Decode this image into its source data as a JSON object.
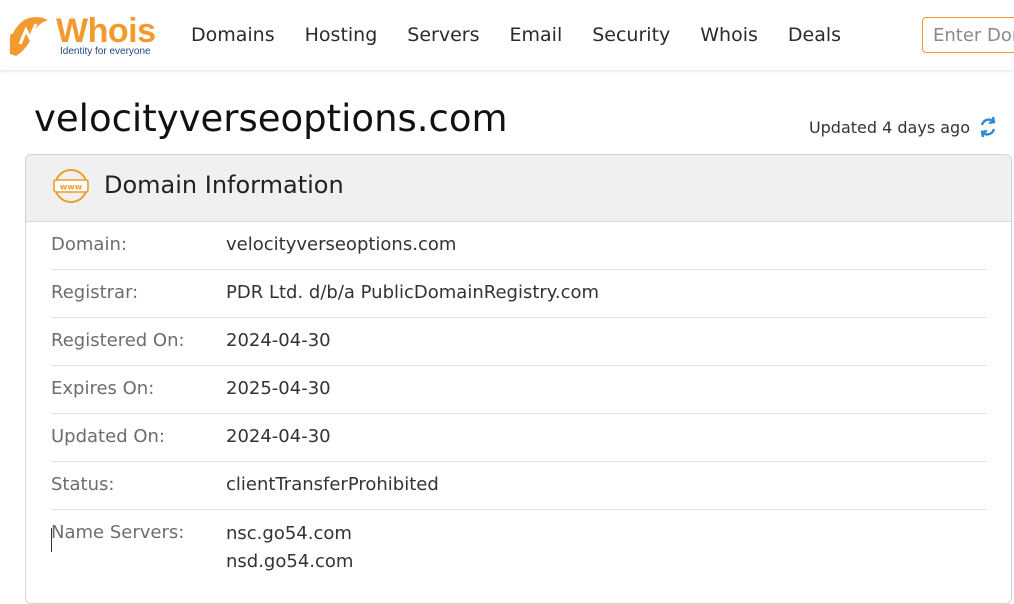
{
  "brand": {
    "name": "Whois",
    "tagline": "Identity for everyone",
    "accent_color": "#f29a2e",
    "secondary_color": "#1f4a7a"
  },
  "nav": {
    "items": [
      "Domains",
      "Hosting",
      "Servers",
      "Email",
      "Security",
      "Whois",
      "Deals"
    ]
  },
  "search": {
    "placeholder": "Enter Domain or IP"
  },
  "page": {
    "domain_title": "velocityverseoptions.com",
    "updated_text": "Updated 4 days ago"
  },
  "card": {
    "title": "Domain Information",
    "icon": "www-icon",
    "rows": [
      {
        "label": "Domain:",
        "value": "velocityverseoptions.com"
      },
      {
        "label": "Registrar:",
        "value": "PDR Ltd. d/b/a PublicDomainRegistry.com"
      },
      {
        "label": "Registered On:",
        "value": "2024-04-30"
      },
      {
        "label": "Expires On:",
        "value": "2025-04-30"
      },
      {
        "label": "Updated On:",
        "value": "2024-04-30"
      },
      {
        "label": "Status:",
        "value": "clientTransferProhibited"
      }
    ],
    "name_servers": {
      "label": "Name Servers:",
      "values": [
        "nsc.go54.com",
        "nsd.go54.com"
      ]
    }
  }
}
